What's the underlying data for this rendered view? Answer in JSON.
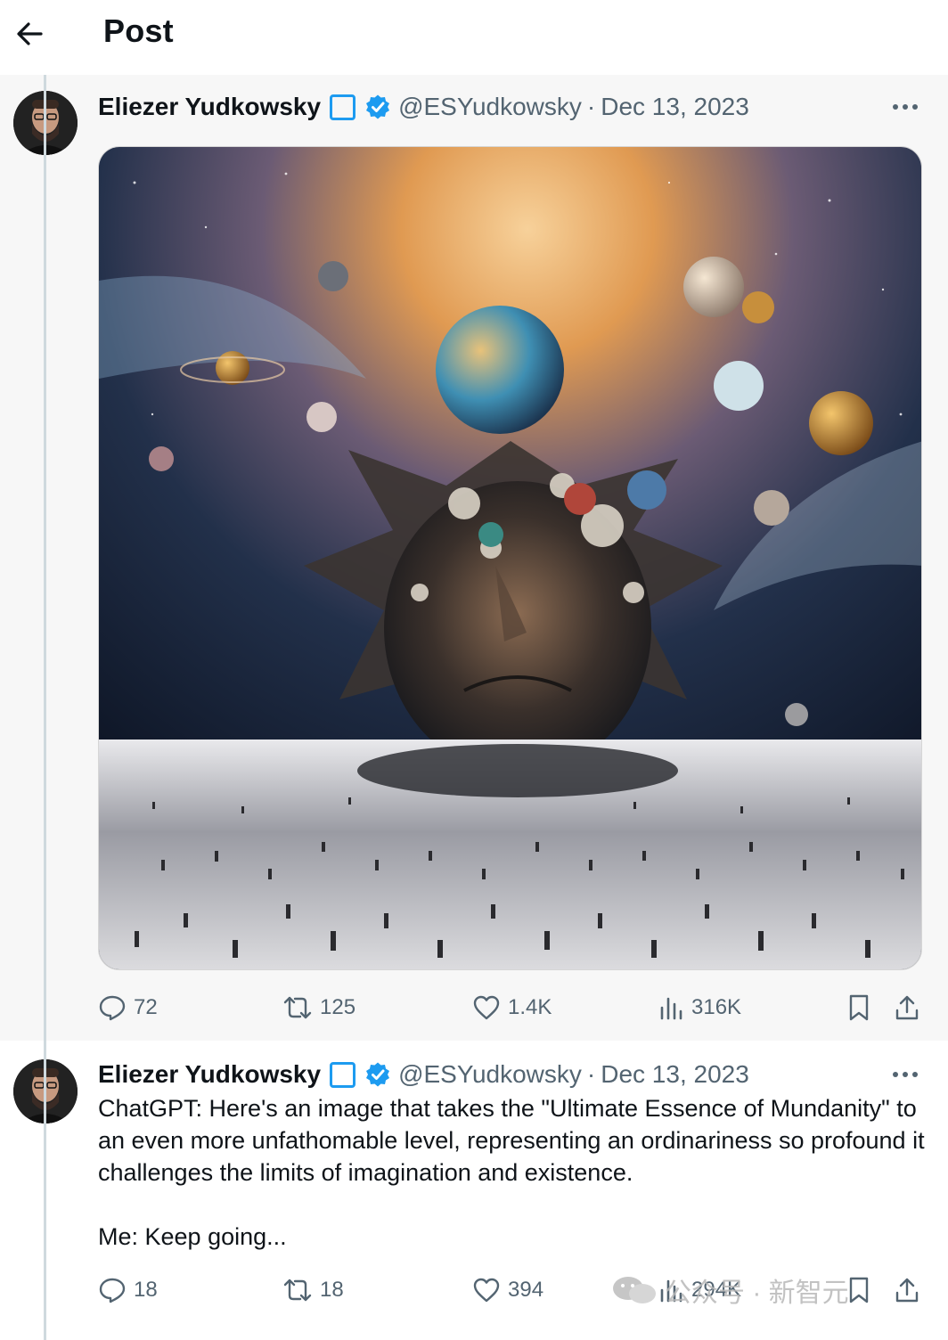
{
  "header": {
    "title": "Post"
  },
  "posts": [
    {
      "author": "Eliezer Yudkowsky",
      "handle": "@ESYudkowsky",
      "separator": "·",
      "date": "Dec 13, 2023",
      "has_image": true,
      "stats": {
        "replies": "72",
        "reposts": "125",
        "likes": "1.4K",
        "views": "316K"
      }
    },
    {
      "author": "Eliezer Yudkowsky",
      "handle": "@ESYudkowsky",
      "separator": "·",
      "date": "Dec 13, 2023",
      "text_line1": "ChatGPT:  Here's an image that takes the \"Ultimate Essence of Mundanity\" to an even more unfathomable level, representing an ordinariness so profound it challenges the limits of imagination and existence.",
      "text_line2": "Me:  Keep going...",
      "stats": {
        "replies": "18",
        "reposts": "18",
        "likes": "394",
        "views": "294K"
      }
    }
  ],
  "watermark": {
    "text": "公众号 · 新智元"
  },
  "colors": {
    "accent": "#1d9bf0",
    "muted": "#536471",
    "text": "#0f1419",
    "thread_line": "#cfd9de"
  }
}
